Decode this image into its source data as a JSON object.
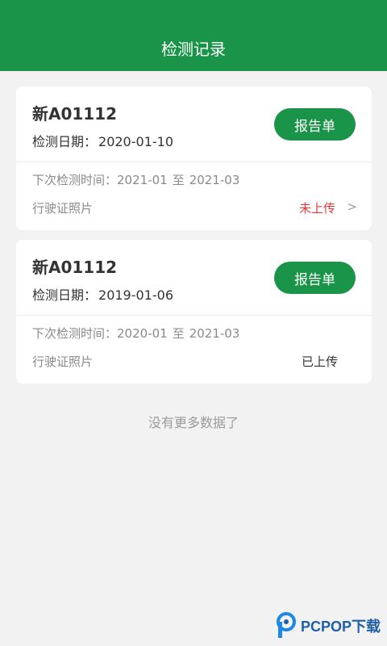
{
  "header": {
    "title": "检测记录"
  },
  "records": [
    {
      "plate": "新A01112",
      "check_date_label": "检测日期：",
      "check_date": "2020-01-10",
      "report_button": "报告单",
      "next_check_label": "下次检测时间：",
      "next_check_from": "2021-01",
      "next_check_to_label": "至",
      "next_check_to": "2021-03",
      "license_label": "行驶证照片",
      "upload_status": "未上传",
      "chevron": ">"
    },
    {
      "plate": "新A01112",
      "check_date_label": "检测日期：",
      "check_date": "2019-01-06",
      "report_button": "报告单",
      "next_check_label": "下次检测时间：",
      "next_check_from": "2020-01",
      "next_check_to_label": "至",
      "next_check_to": "2021-03",
      "license_label": "行驶证照片",
      "upload_status": "已上传"
    }
  ],
  "footer": {
    "no_more": "没有更多数据了"
  },
  "watermark": {
    "brand": "PCPOP下载",
    "logo_icon": "pcpop-logo-icon"
  },
  "colors": {
    "primary": "#1a9448",
    "status_red": "#e53935",
    "text_dark": "#333333",
    "text_gray": "#8a8a8a",
    "background": "#f2f2f2"
  }
}
